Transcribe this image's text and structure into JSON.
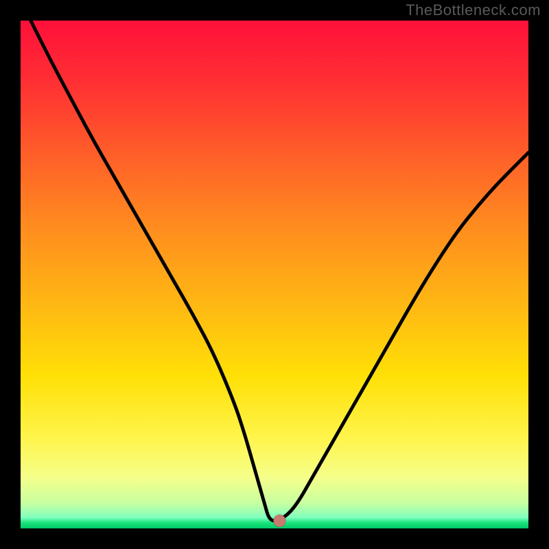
{
  "attribution": "TheBottleneck.com",
  "chart_data": {
    "type": "line",
    "title": "",
    "xlabel": "",
    "ylabel": "",
    "xlim": [
      0,
      100
    ],
    "ylim": [
      0,
      100
    ],
    "series": [
      {
        "name": "bottleneck-curve",
        "x": [
          2,
          6,
          10,
          14,
          18,
          22,
          26,
          30,
          34,
          38,
          42,
          44,
          46,
          48,
          49,
          51,
          54,
          58,
          62,
          66,
          70,
          74,
          78,
          82,
          86,
          90,
          94,
          98,
          100
        ],
        "y": [
          100,
          92,
          84.5,
          77,
          70,
          63,
          56,
          49,
          42,
          34.5,
          25,
          19,
          12,
          5,
          1.5,
          1.5,
          4,
          11,
          18,
          25,
          32,
          39,
          46,
          52.5,
          58.5,
          63.5,
          68,
          72,
          74
        ]
      }
    ],
    "marker": {
      "x": 51,
      "y": 1.5,
      "color": "#c97a6e",
      "radius_px": 9
    },
    "gradient_stops": [
      {
        "pct": 0,
        "color": "#ff103a"
      },
      {
        "pct": 25,
        "color": "#ff5a2a"
      },
      {
        "pct": 55,
        "color": "#ffb514"
      },
      {
        "pct": 82,
        "color": "#fff44a"
      },
      {
        "pct": 100,
        "color": "#18e27a"
      }
    ],
    "grid": false,
    "legend": false
  }
}
